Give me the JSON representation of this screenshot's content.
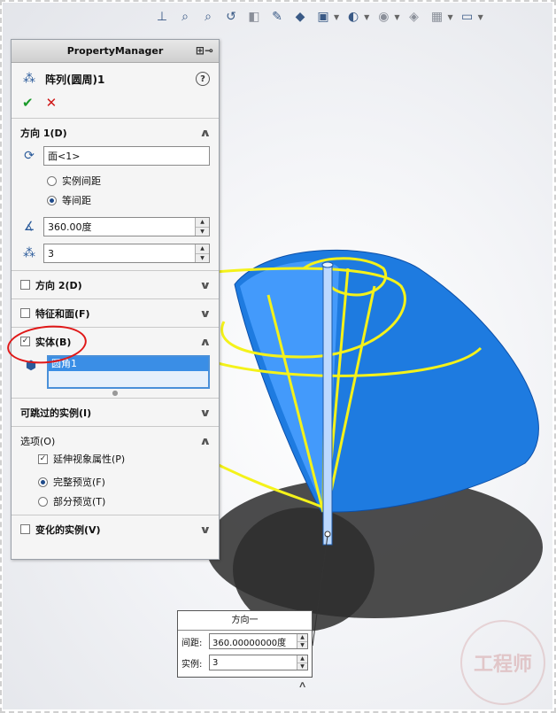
{
  "toolbar": {
    "icons": [
      "view-orientation-icon",
      "zoom-to-fit-icon",
      "zoom-area-icon",
      "previous-view-icon",
      "section-view-icon",
      "dynamic-annotation-icon",
      "display-style-icon",
      "hide-show-icon",
      "view-setting-icon",
      "appearance-icon",
      "scene-icon",
      "monitor-icon"
    ]
  },
  "property_manager": {
    "title": "PropertyManager",
    "feature_name": "阵列(圆周)1",
    "direction1": {
      "header": "方向 1(D)",
      "axis_value": "面<1>",
      "option_instance_spacing": "实例间距",
      "option_equal_spacing": "等间距",
      "selected_option": "等间距",
      "angle_value": "360.00度",
      "count_value": "3"
    },
    "direction2": {
      "header": "方向 2(D)",
      "checked": false
    },
    "features_faces": {
      "header": "特征和面(F)",
      "checked": false
    },
    "bodies": {
      "header": "实体(B)",
      "checked": true,
      "selected_item": "圆角1"
    },
    "skip_instances": {
      "header": "可跳过的实例(I)"
    },
    "options": {
      "header": "选项(O)",
      "propagate_visual": "延伸视象属性(P)",
      "propagate_checked": true,
      "full_preview": "完整预览(F)",
      "partial_preview": "部分预览(T)",
      "selected_preview": "完整预览(F)"
    },
    "vary_instances": {
      "header": "变化的实例(V)",
      "checked": false
    }
  },
  "callout": {
    "title": "方向一",
    "spacing_label": "间距:",
    "spacing_value": "360.00000000度",
    "instances_label": "实例:",
    "instances_value": "3"
  },
  "watermark": {
    "text": "工程师"
  },
  "colors": {
    "cone_blue": "#1e7be0",
    "sketch_yellow": "#f4f21a",
    "selection_blue": "#3a8ee6",
    "annotation_red": "#e01818"
  }
}
